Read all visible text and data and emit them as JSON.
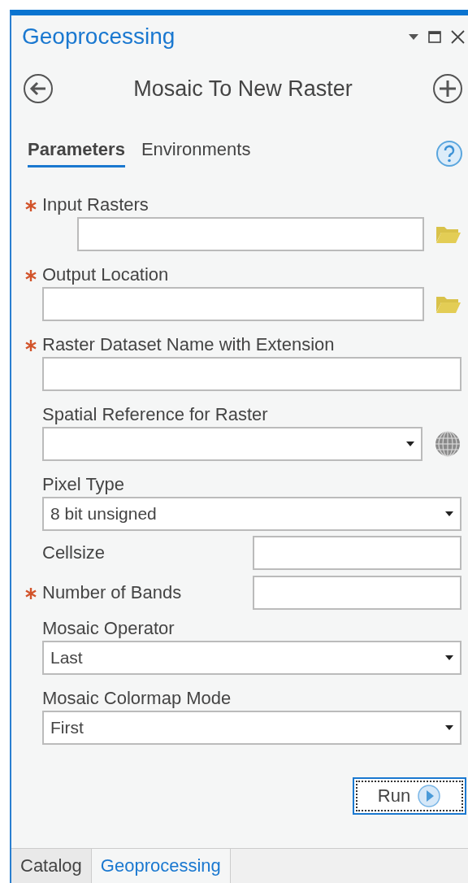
{
  "pane": {
    "title": "Geoprocessing"
  },
  "tool": {
    "title": "Mosaic To New Raster"
  },
  "tabs": [
    {
      "label": "Parameters",
      "selected": true
    },
    {
      "label": "Environments",
      "selected": false
    }
  ],
  "parameters": [
    {
      "kind": "multipath",
      "label": "Input Rasters",
      "required": true
    },
    {
      "kind": "path",
      "label": "Output Location",
      "required": true
    },
    {
      "kind": "text",
      "label": "Raster Dataset Name with Extension",
      "required": true
    },
    {
      "kind": "reference",
      "label": "Spatial Reference for Raster",
      "required": false
    },
    {
      "kind": "dropdown",
      "label": "Pixel Type",
      "required": false,
      "value": "8 bit unsigned"
    },
    {
      "kind": "inline",
      "label": "Cellsize",
      "required": false
    },
    {
      "kind": "inline",
      "label": "Number of Bands",
      "required": true
    },
    {
      "kind": "dropdown",
      "label": "Mosaic Operator",
      "required": false,
      "value": "Last"
    },
    {
      "kind": "dropdown",
      "label": "Mosaic Colormap Mode",
      "required": false,
      "value": "First"
    }
  ],
  "run_button": {
    "label": "Run"
  },
  "bottom_tabs": [
    {
      "label": "Catalog",
      "selected": false
    },
    {
      "label": "Geoprocessing",
      "selected": true
    }
  ]
}
